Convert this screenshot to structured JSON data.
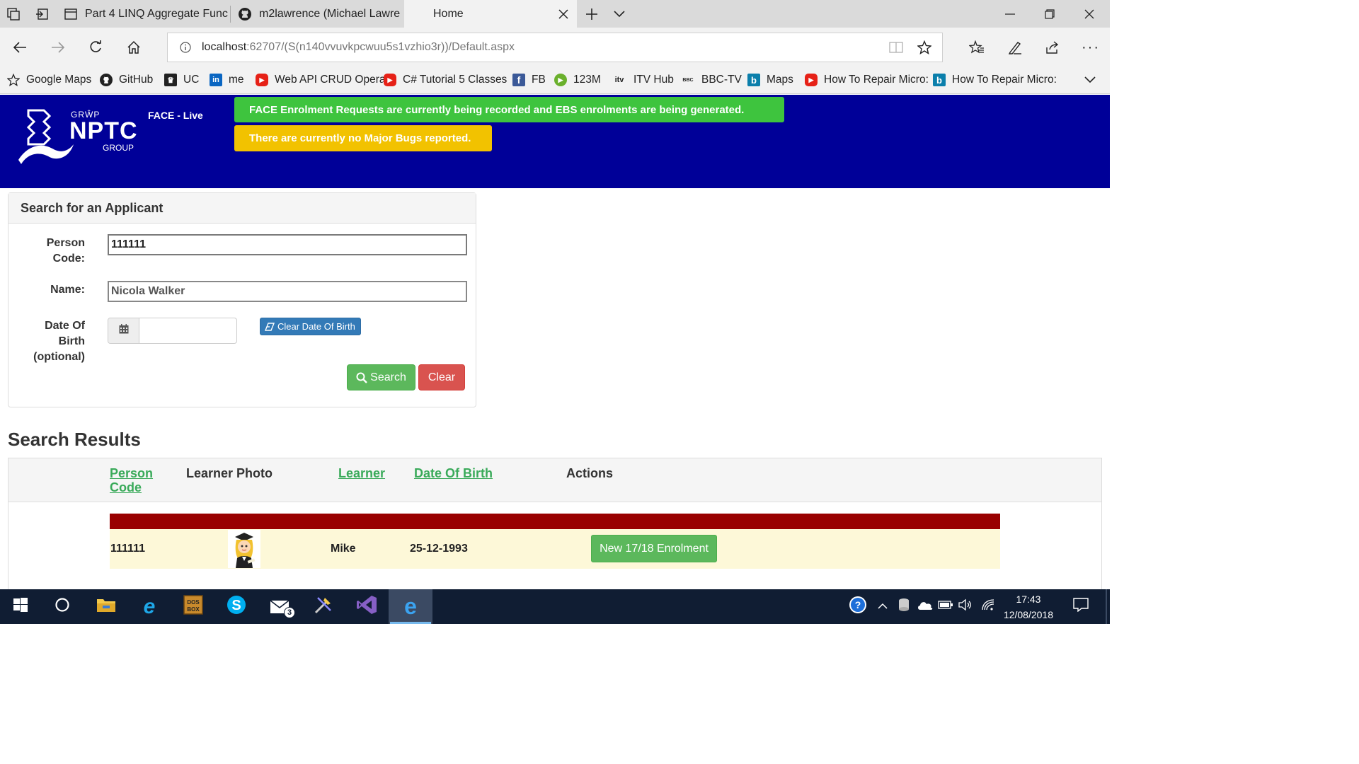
{
  "browser": {
    "tabs": [
      {
        "title": "Part 4 LINQ Aggregate Func",
        "icon": "page-icon"
      },
      {
        "title": "m2lawrence (Michael Lawre",
        "icon": "github-icon"
      },
      {
        "title": "Home",
        "icon": "none",
        "active": true
      }
    ],
    "address": {
      "host": "localhost",
      "rest": ":62707/(S(n140vvuvkpcwuu5s1vzhio3r))/Default.aspx"
    },
    "favorites": [
      {
        "label": "Google Maps",
        "icon": "star-icon"
      },
      {
        "label": "GitHub",
        "icon": "github-icon"
      },
      {
        "label": "UC",
        "icon": "uc-icon"
      },
      {
        "label": "me",
        "icon": "linkedin-icon"
      },
      {
        "label": "Web API CRUD Opera",
        "icon": "youtube-icon"
      },
      {
        "label": "C# Tutorial 5 Classes",
        "icon": "youtube-icon"
      },
      {
        "label": "FB",
        "icon": "facebook-icon"
      },
      {
        "label": "123M",
        "icon": "play-icon"
      },
      {
        "label": "ITV Hub",
        "icon": "itv-icon"
      },
      {
        "label": "BBC-TV",
        "icon": "bbc-icon"
      },
      {
        "label": "Maps",
        "icon": "bing-icon"
      },
      {
        "label": "How To Repair Micro:",
        "icon": "youtube-icon"
      },
      {
        "label": "How To Repair Micro:",
        "icon": "bing-icon"
      }
    ]
  },
  "header": {
    "logo": {
      "top": "GRŴP",
      "main": "NPTC",
      "sub": "GROUP"
    },
    "env_label": "FACE - Live",
    "banners": {
      "green": "FACE Enrolment Requests are currently being recorded and EBS enrolments are being generated.",
      "yellow": "There are currently no Major Bugs reported."
    },
    "colors": {
      "background": "#000098",
      "green": "#3ec43e",
      "yellow": "#f2c200"
    }
  },
  "search": {
    "title": "Search for an Applicant",
    "person_code_label_1": "Person",
    "person_code_label_2": "Code:",
    "person_code_value": "111111",
    "name_label": "Name:",
    "name_value": "Nicola Walker",
    "dob_label_1": "Date Of",
    "dob_label_2": "Birth",
    "dob_label_3": "(optional)",
    "dob_value": "",
    "clear_dob_label": "Clear Date Of Birth",
    "search_label": "Search",
    "clear_label": "Clear"
  },
  "results": {
    "heading": "Search Results",
    "columns": {
      "person_code_1": "Person",
      "person_code_2": "Code",
      "photo": "Learner Photo",
      "learner": "Learner",
      "dob": "Date Of Birth",
      "actions": "Actions"
    },
    "rows": [
      {
        "person_code": "111111",
        "learner": "Mike",
        "dob": "25-12-1993",
        "action_label": "New 17/18 Enrolment"
      }
    ]
  },
  "taskbar": {
    "time": "17:43",
    "date": "12/08/2018",
    "mail_badge": "3"
  }
}
